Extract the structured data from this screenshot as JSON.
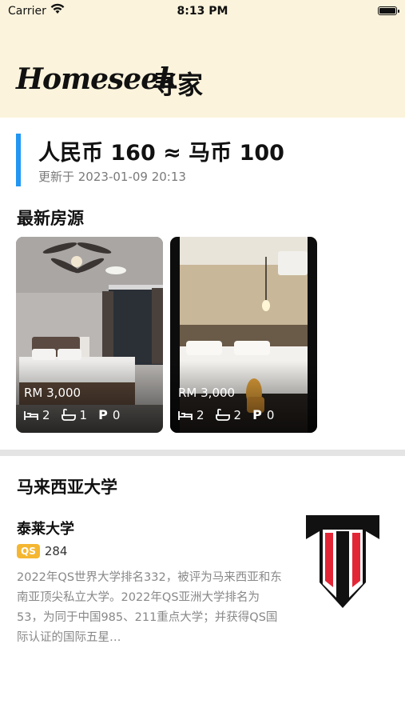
{
  "status_bar": {
    "carrier": "Carrier",
    "time": "8:13 PM"
  },
  "header": {
    "brand": "Homeseek",
    "brand_cn": "寻家"
  },
  "exchange": {
    "rate_text": "人民币 160 ≈ 马币 100",
    "updated": "更新于 2023-01-09 20:13",
    "accent_color": "#2196f3"
  },
  "listings": {
    "title": "最新房源",
    "items": [
      {
        "price": "RM 3,000",
        "bedrooms": "2",
        "bathrooms": "1",
        "parking": "0"
      },
      {
        "price": "RM 3,000",
        "bedrooms": "2",
        "bathrooms": "2",
        "parking": "0"
      }
    ]
  },
  "universities": {
    "title": "马来西亚大学",
    "items": [
      {
        "name": "泰莱大学",
        "badge": "QS",
        "rank": "284",
        "description": "2022年QS世界大学排名332，被评为马来西亚和东南亚顶尖私立大学。2022年QS亚洲大学排名为53，为同于中国985、211重点大学；并获得QS国际认证的国际五星…"
      }
    ]
  },
  "colors": {
    "header_bg": "#fbf3dc",
    "qs_badge": "#f5b731",
    "logo_red": "#e32636"
  }
}
